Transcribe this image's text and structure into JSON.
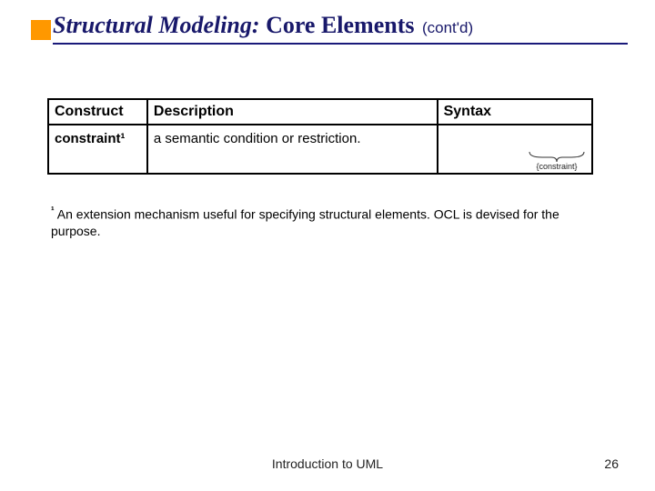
{
  "title": {
    "italic": "Structural Modeling:",
    "rest": " Core Elements",
    "contd": "(cont'd)"
  },
  "table": {
    "headers": {
      "c1": "Construct",
      "c2": "Description",
      "c3": "Syntax"
    },
    "row": {
      "construct": "constraint",
      "construct_sup": "¹",
      "description": "a semantic condition or restriction.",
      "syntax_label": "{constraint}"
    }
  },
  "footnote": {
    "marker": "¹",
    "text": " An extension mechanism useful for specifying structural elements. OCL is devised for the purpose."
  },
  "footer": {
    "center": "Introduction to UML",
    "page": "26"
  }
}
